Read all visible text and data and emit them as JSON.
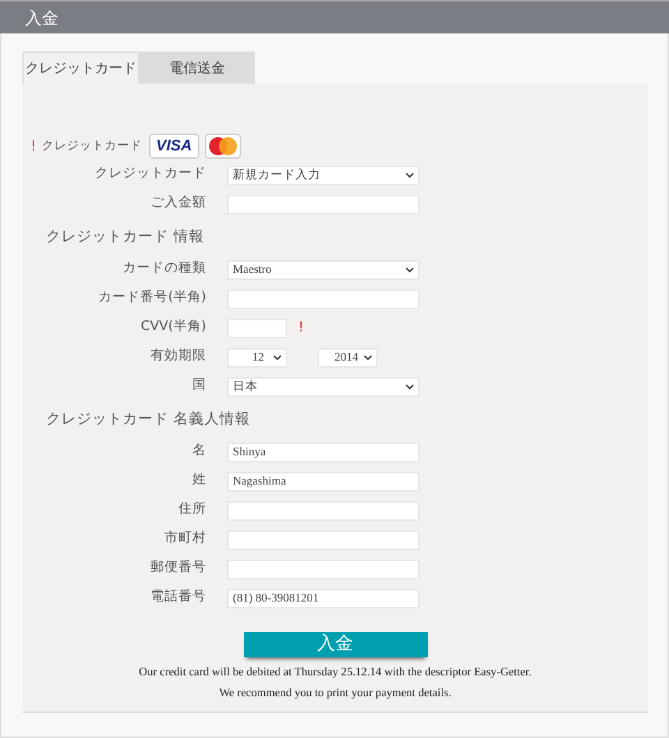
{
  "window": {
    "title": "入金"
  },
  "tabs": [
    {
      "label": "クレジットカード",
      "selected": true
    },
    {
      "label": "電信送金",
      "selected": false
    }
  ],
  "card_logos": {
    "required_mark": "!",
    "label": "クレジットカード",
    "visa": "VISA"
  },
  "sections": [
    {
      "fields": [
        {
          "kind": "select",
          "label": "クレジットカード",
          "value": "新規カード入力"
        },
        {
          "kind": "input",
          "label": "ご入金額"
        }
      ]
    },
    {
      "heading": "クレジットカード 情報",
      "fields": [
        {
          "kind": "select",
          "label": "カードの種類",
          "value": "Maestro"
        },
        {
          "kind": "input",
          "label": "カード番号(半角)"
        },
        {
          "kind": "short",
          "label": "CVV(半角)",
          "required_mark": "!"
        },
        {
          "kind": "expiry",
          "label": "有効期限",
          "month": "12",
          "year": "2014"
        },
        {
          "kind": "select",
          "label": "国",
          "value": "日本"
        }
      ]
    },
    {
      "heading": "クレジットカード 名義人情報",
      "fields": [
        {
          "kind": "input",
          "label": "名",
          "value": "Shinya"
        },
        {
          "kind": "input",
          "label": "姓",
          "value": "Nagashima"
        },
        {
          "kind": "input",
          "label": "住所"
        },
        {
          "kind": "input",
          "label": "市町村"
        },
        {
          "kind": "input",
          "label": "郵便番号"
        },
        {
          "kind": "input",
          "label": "電話番号",
          "value": "(81) 80-39081201"
        }
      ]
    }
  ],
  "submit": {
    "label": "入金"
  },
  "notes": [
    "Our credit card will be debited at Thursday 25.12.14 with the descriptor Easy-Getter.",
    "We recommend you to print your payment details."
  ]
}
